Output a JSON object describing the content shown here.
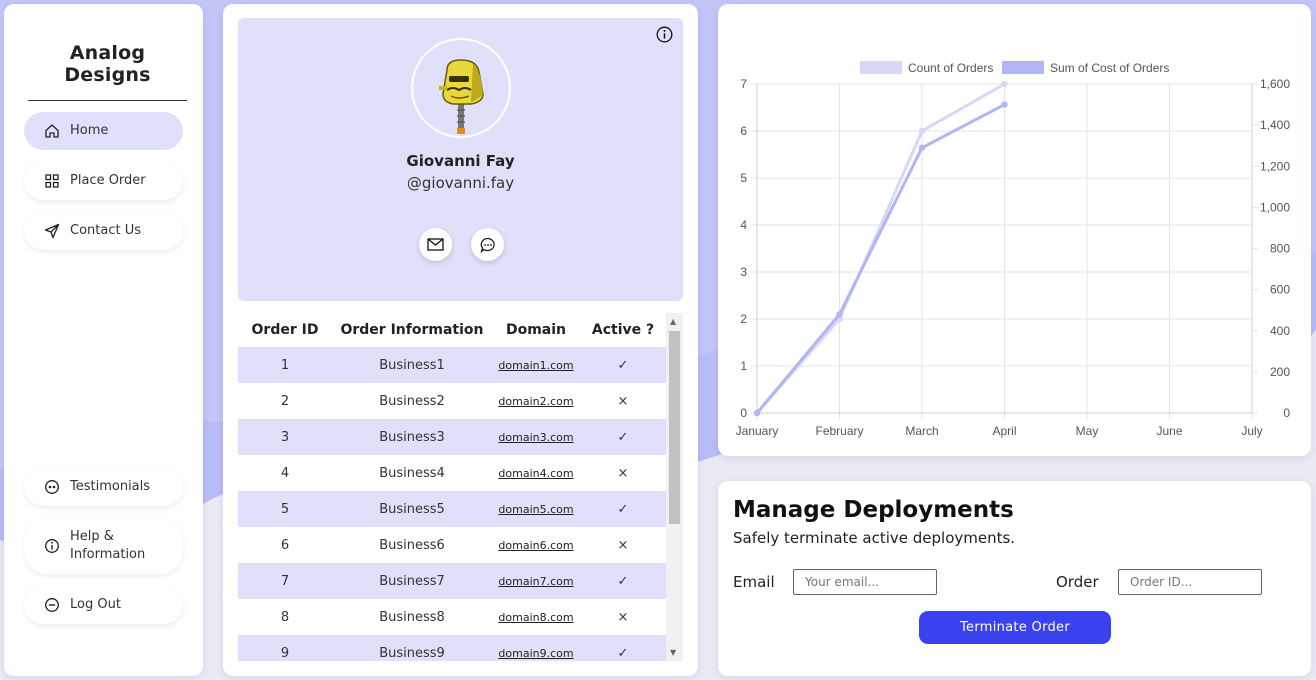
{
  "brand": "Analog Designs",
  "nav": {
    "home": "Home",
    "place_order": "Place Order",
    "contact": "Contact Us",
    "testimonials": "Testimonials",
    "help": "Help & Information",
    "logout": "Log Out"
  },
  "profile": {
    "name": "Giovanni Fay",
    "handle": "@giovanni.fay"
  },
  "orders": {
    "headers": [
      "Order ID",
      "Order Information",
      "Domain",
      "Active ?"
    ],
    "rows": [
      {
        "id": "1",
        "info": "Business1",
        "domain": "domain1.com",
        "active": "✓"
      },
      {
        "id": "2",
        "info": "Business2",
        "domain": "domain2.com",
        "active": "×"
      },
      {
        "id": "3",
        "info": "Business3",
        "domain": "domain3.com",
        "active": "✓"
      },
      {
        "id": "4",
        "info": "Business4",
        "domain": "domain4.com",
        "active": "×"
      },
      {
        "id": "5",
        "info": "Business5",
        "domain": "domain5.com",
        "active": "✓"
      },
      {
        "id": "6",
        "info": "Business6",
        "domain": "domain6.com",
        "active": "×"
      },
      {
        "id": "7",
        "info": "Business7",
        "domain": "domain7.com",
        "active": "✓"
      },
      {
        "id": "8",
        "info": "Business8",
        "domain": "domain8.com",
        "active": "×"
      },
      {
        "id": "9",
        "info": "Business9",
        "domain": "domain9.com",
        "active": "✓"
      }
    ]
  },
  "chart_data": {
    "type": "line",
    "categories": [
      "January",
      "February",
      "March",
      "April",
      "May",
      "June",
      "July"
    ],
    "series": [
      {
        "name": "Count of Orders",
        "axis": "left",
        "color": "#d6d8f5",
        "values": [
          0,
          2,
          6,
          7
        ]
      },
      {
        "name": "Sum of Cost of Orders",
        "axis": "right",
        "color": "#b0b5f5",
        "values": [
          0,
          480,
          1290,
          1500
        ]
      }
    ],
    "y_left": {
      "min": 0,
      "max": 7,
      "ticks": [
        "0",
        "1",
        "2",
        "3",
        "4",
        "5",
        "6",
        "7"
      ]
    },
    "y_right": {
      "min": 0,
      "max": 1600,
      "ticks": [
        "0",
        "200",
        "400",
        "600",
        "800",
        "1,000",
        "1,200",
        "1,400",
        "1,600"
      ]
    },
    "grid": true,
    "legend": "top"
  },
  "deploy": {
    "title": "Manage Deployments",
    "subtitle": "Safely terminate active deployments.",
    "email_label": "Email",
    "email_placeholder": "Your email...",
    "order_label": "Order",
    "order_placeholder": "Order ID...",
    "button": "Terminate Order"
  },
  "colors": {
    "accent": "#3a42f0",
    "highlight": "#e0e0fb"
  }
}
